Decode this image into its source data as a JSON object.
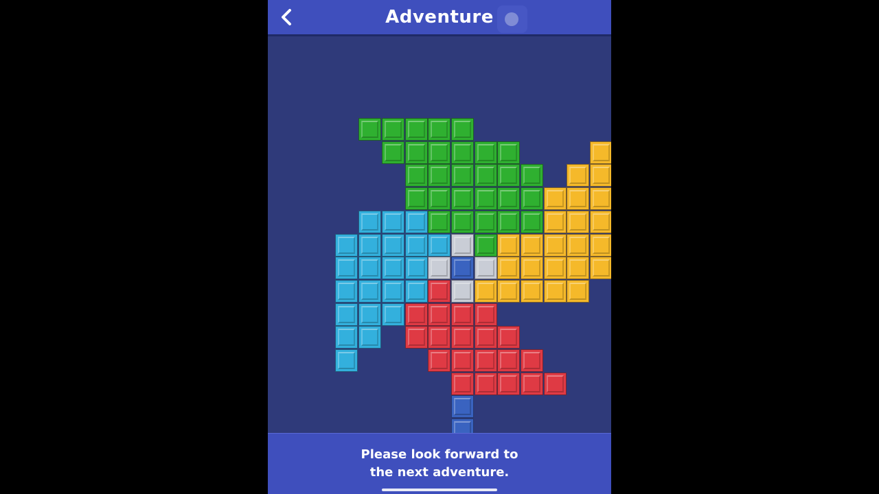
{
  "header": {
    "title": "Adventure",
    "back_icon": "chevron-left-icon",
    "action_icon": "circle-icon"
  },
  "footer": {
    "message": "Please look forward to\nthe next adventure."
  },
  "colors": {
    "background": "#2f3a7a",
    "bar": "#3f4fbd",
    "G": "#2fb030",
    "Y": "#f5b92a",
    "C": "#33b0dd",
    "R": "#df3a44",
    "W": "#c9cdd6",
    "B": "#3a63c0"
  },
  "board": {
    "grid": [
      "...GGGGG......",
      "....GGGGGG...Y",
      ".....GGGGGG.YY",
      ".....GGGGGGYYY",
      "...CCCGGGGGYYY",
      "..CCCCCWGYYYYY",
      "..CCCCWBWYYYYY",
      "..CCCCRWYYYYY.",
      "..CCCRRRR.....",
      "..CC.RRRRR....",
      "..C...RRRRR...",
      ".......RRRRR..",
      ".......B......",
      ".......B......"
    ]
  }
}
